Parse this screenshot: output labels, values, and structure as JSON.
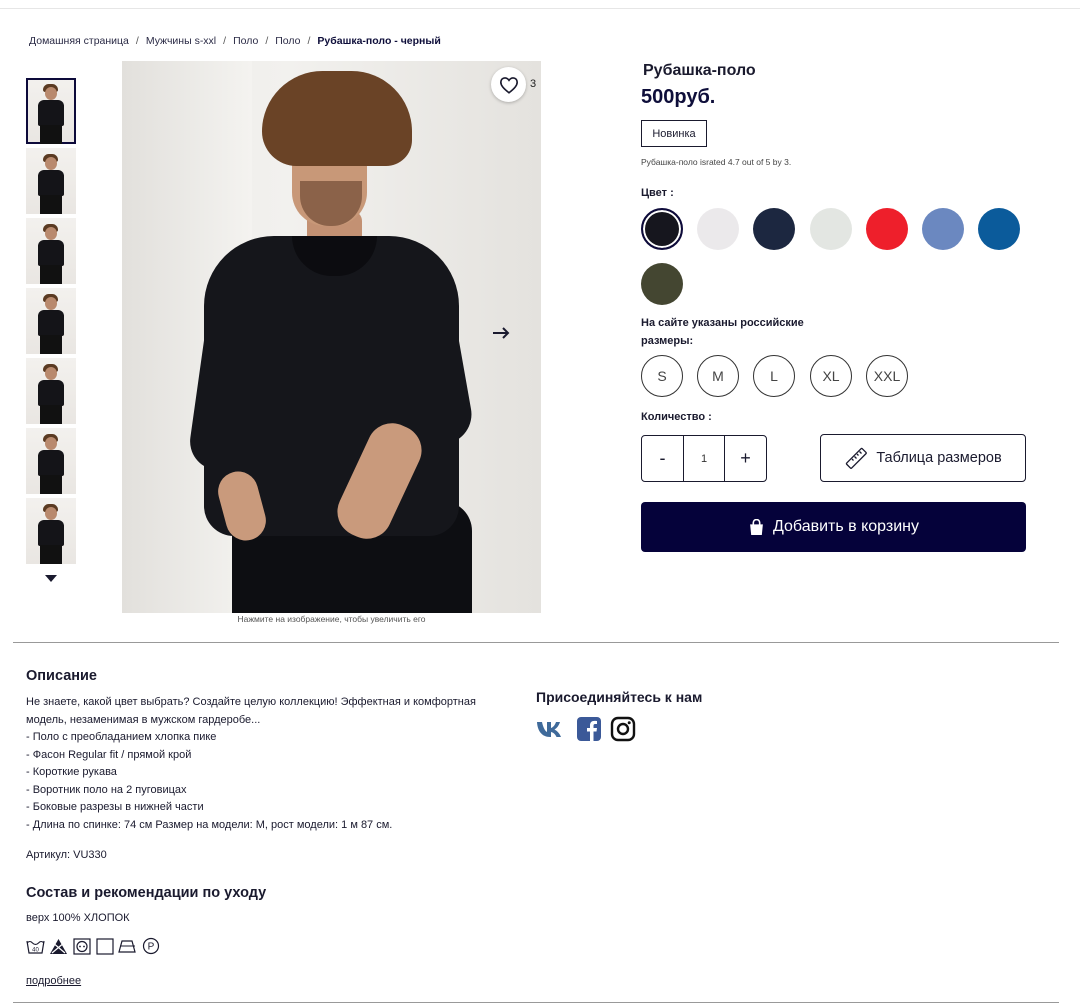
{
  "breadcrumb": {
    "home": "Домашняя страница",
    "men": "Мужчины s-xxl",
    "polo1": "Поло",
    "polo2": "Поло",
    "current": "Рубашка-поло - черный",
    "separator": "/"
  },
  "gallery": {
    "favorite_count": "3",
    "zoom_hint": "Нажмите на изображение, чтобы увеличить его",
    "thumbnail_count": 7
  },
  "product": {
    "title": "Рубашка-поло",
    "price": "500руб.",
    "badge": "Новинка",
    "rating_text": "Рубашка-поло israted 4.7 out of 5 by 3.",
    "color_label": "Цвет :",
    "colors": [
      "#16161e",
      "#ebe9eb",
      "#1c2740",
      "#e3e6e2",
      "#ee1f2b",
      "#6b88c0",
      "#0b5b9b",
      "#444631"
    ],
    "sizes_label": "На сайте указаны российские размеры:",
    "sizes": [
      "S",
      "M",
      "L",
      "XL",
      "XXL"
    ],
    "quantity_label": "Количество :",
    "quantity_minus": "-",
    "quantity_value": "1",
    "quantity_plus": "+",
    "size_table_label": "Таблица размеров",
    "add_to_cart_label": "Добавить в корзину"
  },
  "description": {
    "title": "Описание",
    "lines": [
      "Не знаете, какой цвет выбрать? Создайте целую коллекцию! Эффектная и комфортная",
      "модель, незаменимая в мужском гардеробе...",
      "- Поло с преобладанием хлопка пике",
      "- Фасон Regular fit / прямой крой",
      "- Короткие рукава",
      "- Воротник поло на 2 пуговицах",
      "- Боковые разрезы в нижней части",
      "- Длина по спинке: 74 см Размер на модели: M, рост модели: 1 м 87 см."
    ],
    "article": "Артикул: VU330"
  },
  "care": {
    "title": "Состав и рекомендации по уходу",
    "composition": "верх 100% ХЛОПОК",
    "wash_temp": "40",
    "icons": [
      "wash-40-icon",
      "no-bleach-icon",
      "tumble-dry-icon",
      "dry-flat-icon",
      "iron-icon",
      "dry-clean-p-icon"
    ],
    "more_link": "подробнее"
  },
  "social": {
    "title": "Присоединяйтесь к нам",
    "networks": [
      "vk-icon",
      "facebook-icon",
      "instagram-icon"
    ]
  },
  "colors": {
    "brand_dark": "#05023a",
    "text": "#1a1a2e"
  }
}
